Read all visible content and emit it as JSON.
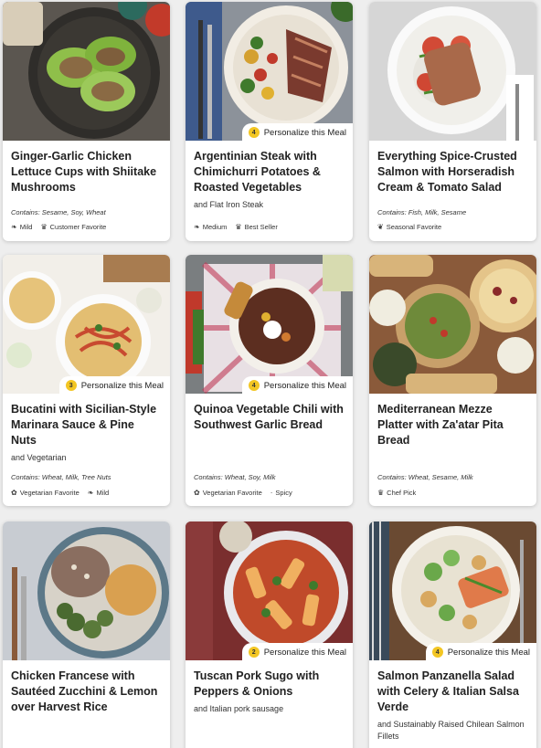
{
  "meals": [
    {
      "title": "Ginger-Garlic Chicken Lettuce Cups with Shiitake Mushrooms",
      "subtitle": "",
      "contains": "Contains: Sesame, Soy, Wheat",
      "personalize": null,
      "tags": [
        {
          "icon": "pepper-icon",
          "glyph": "❧",
          "label": "Mild"
        },
        {
          "icon": "chef-hat-icon",
          "glyph": "♛",
          "label": "Customer Favorite"
        }
      ]
    },
    {
      "title": "Argentinian Steak with Chimichurri Potatoes & Roasted Vegetables",
      "subtitle": "and Flat Iron Steak",
      "contains": "",
      "personalize": {
        "count": "4",
        "label": "Personalize this Meal"
      },
      "tags": [
        {
          "icon": "pepper-icon",
          "glyph": "❧",
          "label": "Medium"
        },
        {
          "icon": "chef-hat-icon",
          "glyph": "♛",
          "label": "Best Seller"
        }
      ]
    },
    {
      "title": "Everything Spice-Crusted Salmon with Horseradish Cream & Tomato Salad",
      "subtitle": "",
      "contains": "Contains: Fish, Milk, Sesame",
      "personalize": null,
      "tags": [
        {
          "icon": "leaf-icon",
          "glyph": "❦",
          "label": "Seasonal Favorite"
        }
      ]
    },
    {
      "title": "Bucatini with Sicilian-Style Marinara Sauce & Pine Nuts",
      "subtitle": "and Vegetarian",
      "contains": "Contains: Wheat, Milk, Tree Nuts",
      "personalize": {
        "count": "3",
        "label": "Personalize this Meal"
      },
      "tags": [
        {
          "icon": "sprout-icon",
          "glyph": "✿",
          "label": "Vegetarian Favorite"
        },
        {
          "icon": "pepper-icon",
          "glyph": "❧",
          "label": "Mild"
        }
      ]
    },
    {
      "title": "Quinoa Vegetable Chili with Southwest Garlic Bread",
      "subtitle": "",
      "contains": "Contains: Wheat, Soy, Milk",
      "personalize": {
        "count": "4",
        "label": "Personalize this Meal"
      },
      "tags": [
        {
          "icon": "sprout-icon",
          "glyph": "✿",
          "label": "Vegetarian Favorite"
        },
        {
          "icon": "",
          "glyph": "·",
          "label": "Spicy"
        }
      ]
    },
    {
      "title": "Mediterranean Mezze Platter with Za'atar Pita Bread",
      "subtitle": "",
      "contains": "Contains: Wheat, Sesame, Milk",
      "personalize": null,
      "tags": [
        {
          "icon": "chef-hat-icon",
          "glyph": "♛",
          "label": "Chef Pick"
        }
      ]
    },
    {
      "title": "Chicken Francese with Sautéed Zucchini & Lemon over Harvest Rice",
      "subtitle": "",
      "contains": "",
      "personalize": null,
      "tags": []
    },
    {
      "title": "Tuscan Pork Sugo with Peppers & Onions",
      "subtitle": "and Italian pork sausage",
      "contains": "",
      "personalize": {
        "count": "2",
        "label": "Personalize this Meal"
      },
      "tags": []
    },
    {
      "title": "Salmon Panzanella Salad with Celery & Italian Salsa Verde",
      "subtitle": "and Sustainably Raised Chilean Salmon Fillets",
      "contains": "",
      "personalize": {
        "count": "4",
        "label": "Personalize this Meal"
      },
      "tags": []
    }
  ],
  "colors": {
    "badge": "#f3c623",
    "card": "#ffffff",
    "background": "#eeeeee"
  }
}
